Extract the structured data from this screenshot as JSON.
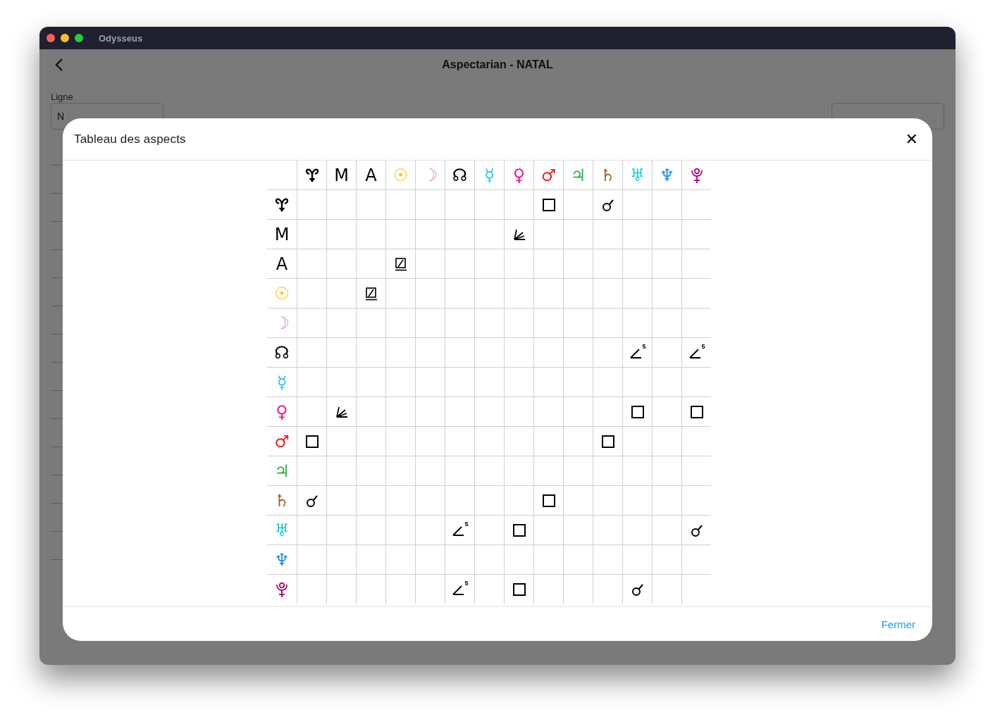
{
  "window": {
    "title": "Odysseus"
  },
  "page": {
    "title": "Aspectarian - NATAL",
    "lines_label": "Ligne",
    "lines_field": {
      "value": "N"
    }
  },
  "dialog": {
    "title": "Tableau des aspects",
    "close": "✕",
    "footer_button": "Fermer",
    "table": {
      "columns": [
        {
          "kind": "vertex",
          "color": "#000000"
        },
        {
          "kind": "glyph",
          "glyph": "M",
          "color": "#000000"
        },
        {
          "kind": "glyph",
          "glyph": "A",
          "color": "#000000"
        },
        {
          "kind": "glyph",
          "glyph": "☉",
          "color": "#f5c400"
        },
        {
          "kind": "glyph",
          "glyph": "☽",
          "color": "#d88ad8"
        },
        {
          "kind": "glyph",
          "glyph": "☊",
          "color": "#000000"
        },
        {
          "kind": "glyph",
          "glyph": "☿",
          "color": "#29c3ec"
        },
        {
          "kind": "glyph",
          "glyph": "♀",
          "color": "#ee1a8c"
        },
        {
          "kind": "glyph",
          "glyph": "♂",
          "color": "#ee1c1c"
        },
        {
          "kind": "glyph",
          "glyph": "♃",
          "color": "#22b04c"
        },
        {
          "kind": "glyph",
          "glyph": "♄",
          "color": "#a0622c"
        },
        {
          "kind": "glyph",
          "glyph": "♅",
          "color": "#20ccd0"
        },
        {
          "kind": "glyph",
          "glyph": "♆",
          "color": "#1a8cf0"
        },
        {
          "kind": "pluto",
          "color": "#b0137a"
        }
      ],
      "rows": [
        {
          "header": {
            "kind": "vertex",
            "color": "#000000"
          },
          "cells": [
            null,
            null,
            null,
            null,
            null,
            null,
            null,
            null,
            {
              "kind": "square"
            },
            null,
            {
              "kind": "conjunction"
            },
            null,
            null,
            null
          ]
        },
        {
          "header": {
            "kind": "glyph",
            "glyph": "M",
            "color": "#000000"
          },
          "cells": [
            null,
            null,
            null,
            null,
            null,
            null,
            null,
            {
              "kind": "fan"
            },
            null,
            null,
            null,
            null,
            null,
            null
          ]
        },
        {
          "header": {
            "kind": "glyph",
            "glyph": "A",
            "color": "#000000"
          },
          "cells": [
            null,
            null,
            null,
            {
              "kind": "slashed_square"
            },
            null,
            null,
            null,
            null,
            null,
            null,
            null,
            null,
            null,
            null
          ]
        },
        {
          "header": {
            "kind": "glyph",
            "glyph": "☉",
            "color": "#f5c400"
          },
          "cells": [
            null,
            null,
            {
              "kind": "slashed_square"
            },
            null,
            null,
            null,
            null,
            null,
            null,
            null,
            null,
            null,
            null,
            null
          ]
        },
        {
          "header": {
            "kind": "glyph",
            "glyph": "☽",
            "color": "#d88ad8"
          },
          "cells": [
            null,
            null,
            null,
            null,
            null,
            null,
            null,
            null,
            null,
            null,
            null,
            null,
            null,
            null
          ]
        },
        {
          "header": {
            "kind": "glyph",
            "glyph": "☊",
            "color": "#000000"
          },
          "cells": [
            null,
            null,
            null,
            null,
            null,
            null,
            null,
            null,
            null,
            null,
            null,
            {
              "kind": "angle",
              "label": "5"
            },
            null,
            {
              "kind": "angle",
              "label": "5"
            }
          ]
        },
        {
          "header": {
            "kind": "glyph",
            "glyph": "☿",
            "color": "#29c3ec"
          },
          "cells": [
            null,
            null,
            null,
            null,
            null,
            null,
            null,
            null,
            null,
            null,
            null,
            null,
            null,
            null
          ]
        },
        {
          "header": {
            "kind": "glyph",
            "glyph": "♀",
            "color": "#ee1a8c"
          },
          "cells": [
            null,
            {
              "kind": "fan"
            },
            null,
            null,
            null,
            null,
            null,
            null,
            null,
            null,
            null,
            {
              "kind": "square"
            },
            null,
            {
              "kind": "square"
            }
          ]
        },
        {
          "header": {
            "kind": "glyph",
            "glyph": "♂",
            "color": "#ee1c1c"
          },
          "cells": [
            {
              "kind": "square"
            },
            null,
            null,
            null,
            null,
            null,
            null,
            null,
            null,
            null,
            {
              "kind": "square"
            },
            null,
            null,
            null
          ]
        },
        {
          "header": {
            "kind": "glyph",
            "glyph": "♃",
            "color": "#22b04c"
          },
          "cells": [
            null,
            null,
            null,
            null,
            null,
            null,
            null,
            null,
            null,
            null,
            null,
            null,
            null,
            null
          ]
        },
        {
          "header": {
            "kind": "glyph",
            "glyph": "♄",
            "color": "#a0622c"
          },
          "cells": [
            {
              "kind": "conjunction"
            },
            null,
            null,
            null,
            null,
            null,
            null,
            null,
            {
              "kind": "square"
            },
            null,
            null,
            null,
            null,
            null
          ]
        },
        {
          "header": {
            "kind": "glyph",
            "glyph": "♅",
            "color": "#20ccd0"
          },
          "cells": [
            null,
            null,
            null,
            null,
            null,
            {
              "kind": "angle",
              "label": "5"
            },
            null,
            {
              "kind": "square"
            },
            null,
            null,
            null,
            null,
            null,
            {
              "kind": "conjunction"
            }
          ]
        },
        {
          "header": {
            "kind": "glyph",
            "glyph": "♆",
            "color": "#1a8cf0"
          },
          "cells": [
            null,
            null,
            null,
            null,
            null,
            null,
            null,
            null,
            null,
            null,
            null,
            null,
            null,
            null
          ]
        },
        {
          "header": {
            "kind": "pluto",
            "color": "#b0137a"
          },
          "cells": [
            null,
            null,
            null,
            null,
            null,
            {
              "kind": "angle",
              "label": "5"
            },
            null,
            {
              "kind": "square"
            },
            null,
            null,
            null,
            {
              "kind": "conjunction"
            },
            null,
            null
          ]
        }
      ]
    }
  }
}
